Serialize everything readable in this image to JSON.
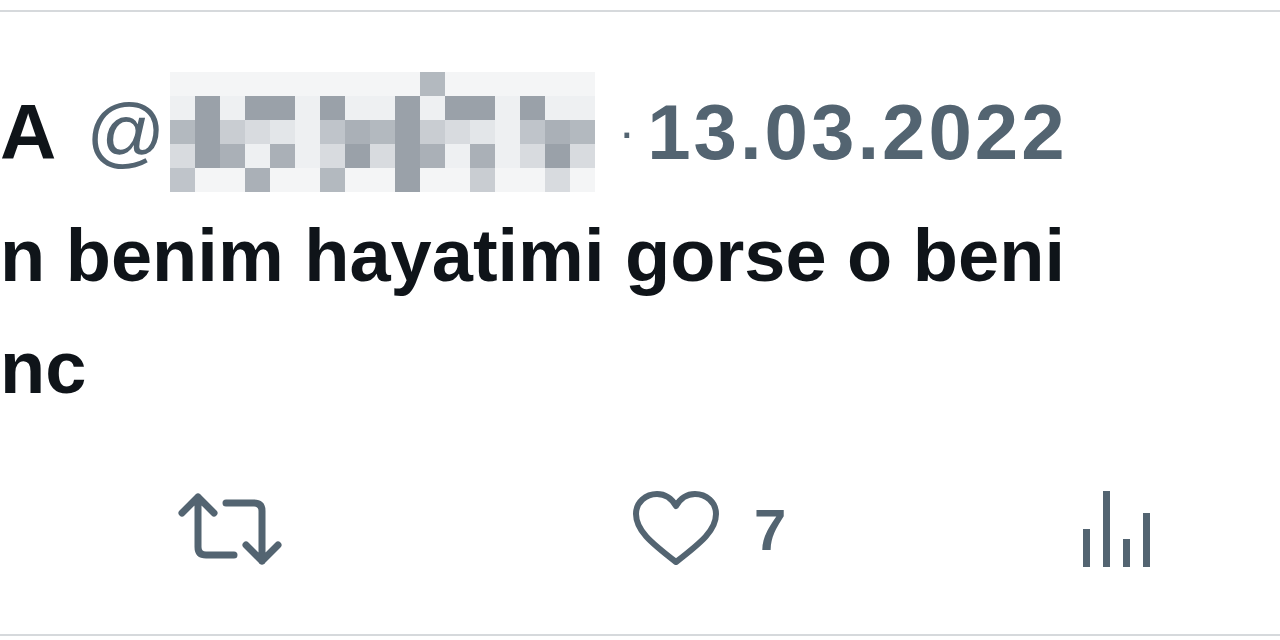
{
  "tweet": {
    "name": "A",
    "handle_prefix": "@",
    "separator": "·",
    "date": "13.03.2022",
    "lines": [
      "n benim hayatimi gorse o beni",
      "nc"
    ],
    "actions": [
      {
        "kind": "retweet"
      },
      {
        "kind": "like",
        "count": "7"
      },
      {
        "kind": "views"
      }
    ]
  }
}
